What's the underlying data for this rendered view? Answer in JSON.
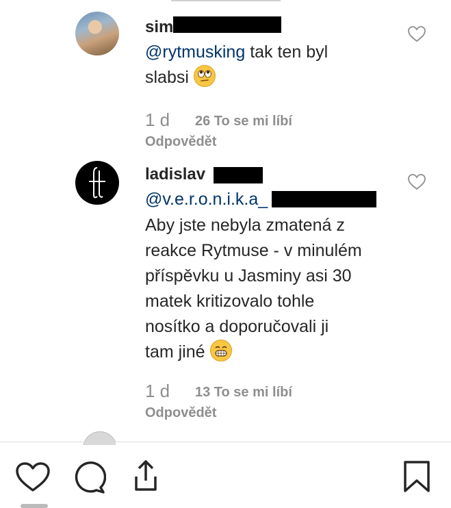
{
  "comments": [
    {
      "username": "sim",
      "body_mention": "@rytmusking",
      "body_text_1": " tak ten byl",
      "body_text_2": "slabsi",
      "time": "1 d",
      "likes": "26 To se mi líbí",
      "reply": "Odpovědět",
      "emoji": "eye-roll-emoji"
    },
    {
      "username": "ladislav",
      "mention": "@v.e.r.o.n.i.k.a_",
      "lines": [
        "Aby jste nebyla zmatená z",
        "reakce Rytmuse - v minulém",
        "příspěvku u Jasminy asi 30",
        "matek kritizovalo tohle",
        "nosítko a doporučovali ji",
        "tam jiné"
      ],
      "time": "1 d",
      "likes": "13 To se mi líbí",
      "reply": "Odpovědět",
      "emoji": "grin-emoji"
    }
  ],
  "action_bar": {
    "icons": [
      "heart-icon",
      "comment-icon",
      "share-icon",
      "bookmark-icon"
    ]
  },
  "colors": {
    "text": "#262626",
    "mention": "#003569",
    "meta": "#8e8e8e",
    "divider": "#dbdbdb"
  }
}
